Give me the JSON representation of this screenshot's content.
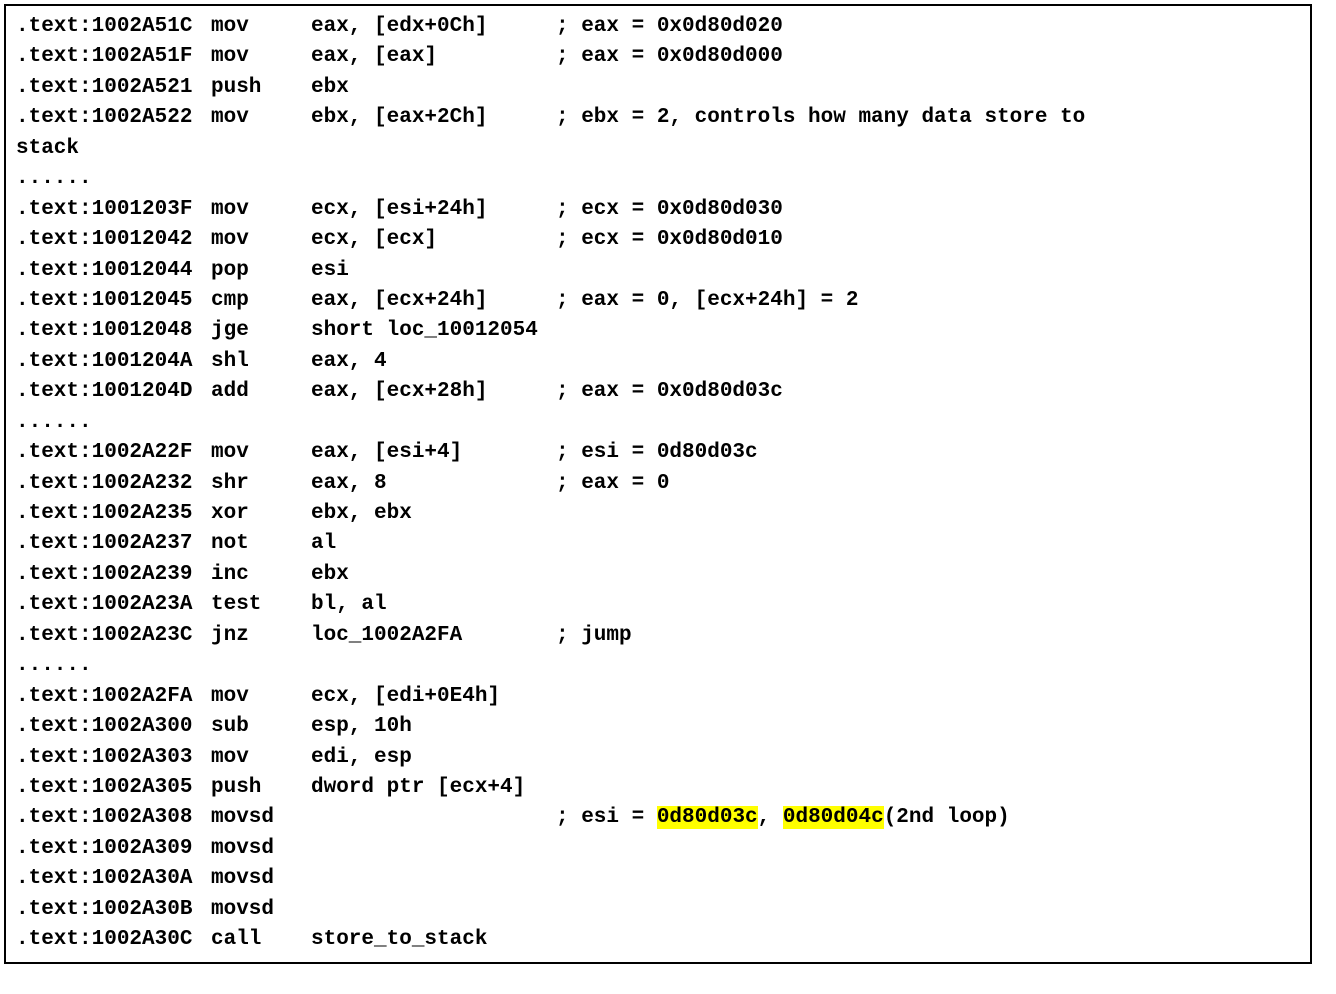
{
  "lines": [
    {
      "addr": ".text:1002A51C",
      "mnem": "mov",
      "oper": "eax, [edx+0Ch]",
      "comm": "; eax = 0x0d80d020"
    },
    {
      "addr": ".text:1002A51F",
      "mnem": "mov",
      "oper": "eax, [eax]",
      "comm": "; eax = 0x0d80d000"
    },
    {
      "addr": ".text:1002A521",
      "mnem": "push",
      "oper": "ebx",
      "comm": ""
    },
    {
      "addr": ".text:1002A522",
      "mnem": "mov",
      "oper": "ebx, [eax+2Ch]",
      "comm": "; ebx = 2, controls how many data store to",
      "wrap": "stack"
    },
    {
      "raw": "......"
    },
    {
      "addr": ".text:1001203F",
      "mnem": "mov",
      "oper": "ecx, [esi+24h]",
      "comm": "; ecx = 0x0d80d030"
    },
    {
      "addr": ".text:10012042",
      "mnem": "mov",
      "oper": "ecx, [ecx]",
      "comm": "; ecx = 0x0d80d010"
    },
    {
      "addr": ".text:10012044",
      "mnem": "pop",
      "oper": "esi",
      "comm": ""
    },
    {
      "addr": ".text:10012045",
      "mnem": "cmp",
      "oper": "eax, [ecx+24h]",
      "comm": "; eax = 0, [ecx+24h] = 2"
    },
    {
      "addr": ".text:10012048",
      "mnem": "jge",
      "oper": "short loc_10012054",
      "comm": ""
    },
    {
      "addr": ".text:1001204A",
      "mnem": "shl",
      "oper": "eax, 4",
      "comm": ""
    },
    {
      "addr": ".text:1001204D",
      "mnem": "add",
      "oper": "eax, [ecx+28h]",
      "comm": "; eax = 0x0d80d03c"
    },
    {
      "raw": "......"
    },
    {
      "addr": ".text:1002A22F",
      "mnem": "mov",
      "oper": "eax, [esi+4]",
      "comm": "; esi = 0d80d03c"
    },
    {
      "addr": ".text:1002A232",
      "mnem": "shr",
      "oper": "eax, 8",
      "comm": "; eax = 0"
    },
    {
      "addr": ".text:1002A235",
      "mnem": "xor",
      "oper": "ebx, ebx",
      "comm": ""
    },
    {
      "addr": ".text:1002A237",
      "mnem": "not",
      "oper": "al",
      "comm": ""
    },
    {
      "addr": ".text:1002A239",
      "mnem": "inc",
      "oper": "ebx",
      "comm": ""
    },
    {
      "addr": ".text:1002A23A",
      "mnem": "test",
      "oper": "bl, al",
      "comm": ""
    },
    {
      "addr": ".text:1002A23C",
      "mnem": "jnz",
      "oper": "loc_1002A2FA",
      "comm": "; jump"
    },
    {
      "raw": "......"
    },
    {
      "addr": ".text:1002A2FA",
      "mnem": "mov",
      "oper": "ecx, [edi+0E4h]",
      "comm": ""
    },
    {
      "addr": ".text:1002A300",
      "mnem": "sub",
      "oper": "esp, 10h",
      "comm": ""
    },
    {
      "addr": ".text:1002A303",
      "mnem": "mov",
      "oper": "edi, esp",
      "comm": ""
    },
    {
      "addr": ".text:1002A305",
      "mnem": "push",
      "oper": "dword ptr [ecx+4]",
      "comm": ""
    },
    {
      "addr": ".text:1002A308",
      "mnem": "movsd",
      "oper": "",
      "comm_pre": "; esi = ",
      "hl1": "0d80d03c",
      "comm_mid": ", ",
      "hl2": "0d80d04c",
      "comm_post": "(2nd loop)"
    },
    {
      "addr": ".text:1002A309",
      "mnem": "movsd",
      "oper": "",
      "comm": ""
    },
    {
      "addr": ".text:1002A30A",
      "mnem": "movsd",
      "oper": "",
      "comm": ""
    },
    {
      "addr": ".text:1002A30B",
      "mnem": "movsd",
      "oper": "",
      "comm": ""
    },
    {
      "addr": ".text:1002A30C",
      "mnem": "call",
      "oper": "store_to_stack",
      "comm": ""
    }
  ]
}
